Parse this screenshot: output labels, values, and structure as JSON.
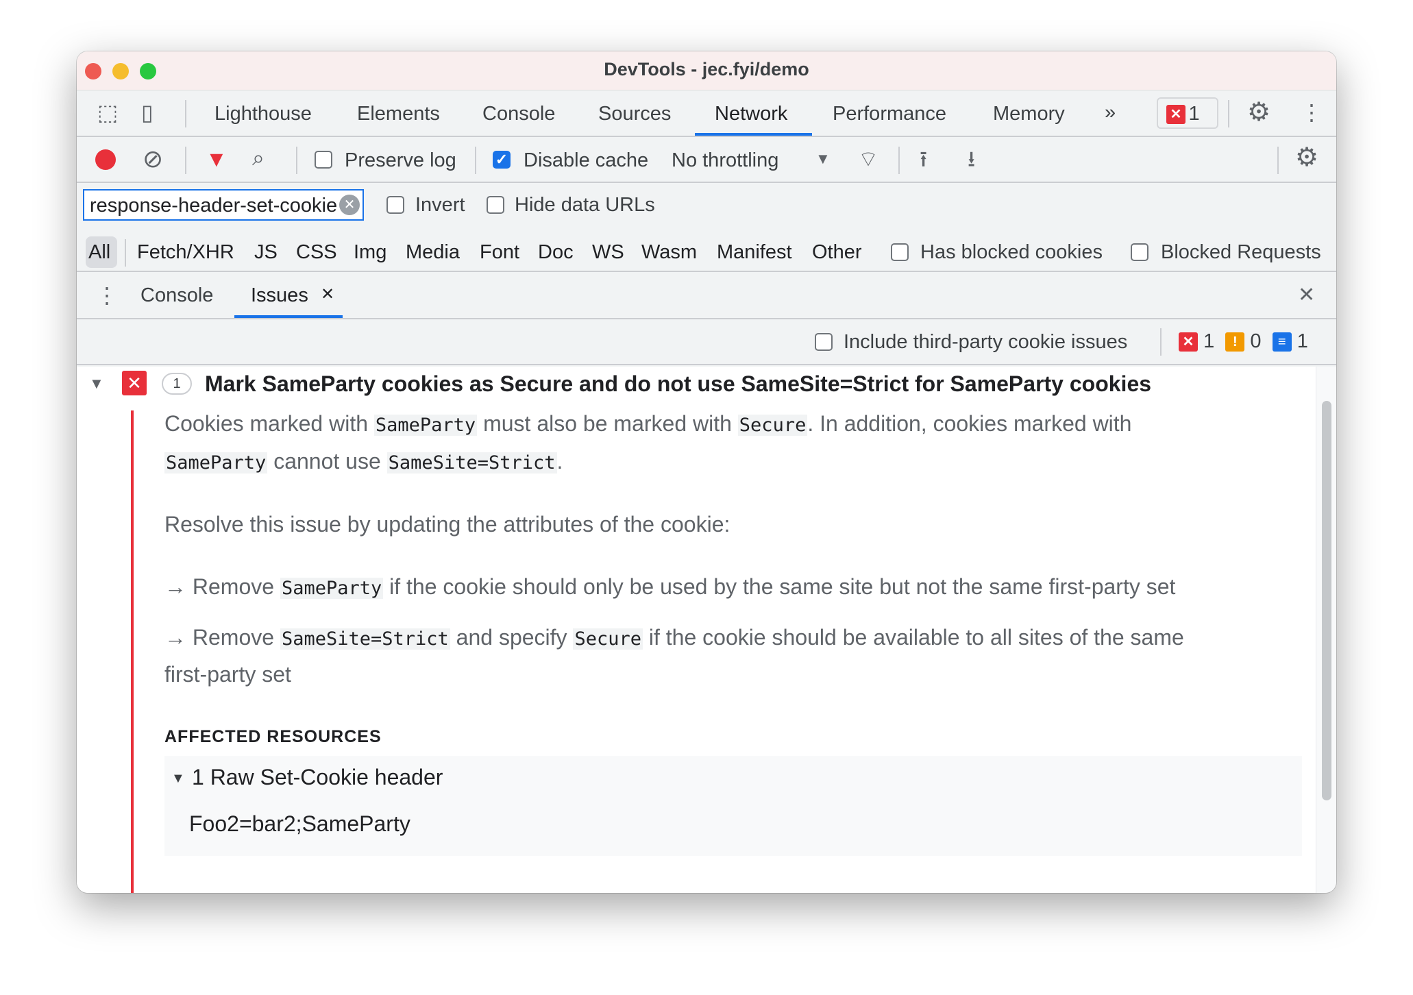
{
  "window": {
    "title": "DevTools - jec.fyi/demo"
  },
  "tabs": [
    {
      "label": "Lighthouse"
    },
    {
      "label": "Elements"
    },
    {
      "label": "Console"
    },
    {
      "label": "Sources"
    },
    {
      "label": "Network",
      "active": true
    },
    {
      "label": "Performance"
    },
    {
      "label": "Memory"
    }
  ],
  "tabs_more": "»",
  "issue_badge_count": "1",
  "toolbar": {
    "preserve_log": "Preserve log",
    "preserve_log_checked": false,
    "disable_cache": "Disable cache",
    "disable_cache_checked": true,
    "throttling": "No throttling"
  },
  "filter": {
    "value": "response-header-set-cookie",
    "invert": "Invert",
    "hide_data_urls": "Hide data URLs"
  },
  "types": [
    "All",
    "Fetch/XHR",
    "JS",
    "CSS",
    "Img",
    "Media",
    "Font",
    "Doc",
    "WS",
    "Wasm",
    "Manifest",
    "Other"
  ],
  "type_checks": {
    "has_blocked": "Has blocked cookies",
    "blocked_requests": "Blocked Requests"
  },
  "drawer": {
    "tabs": [
      "Console",
      "Issues"
    ],
    "active": "Issues",
    "close_glyph": "✕"
  },
  "issues_toolbar": {
    "third_party": "Include third-party cookie issues",
    "errors": "1",
    "warnings": "0",
    "info": "1"
  },
  "issue": {
    "count": "1",
    "title": "Mark SameParty cookies as Secure and do not use SameSite=Strict for SameParty cookies",
    "p1": [
      "Cookies marked with ",
      "SameParty",
      " must also be marked with ",
      "Secure",
      ". In addition, cookies marked with"
    ],
    "p1b": [
      "SameParty",
      " cannot use ",
      "SameSite=Strict",
      "."
    ],
    "p2": "Resolve this issue by updating the attributes of the cookie:",
    "b1": [
      "→ Remove ",
      "SameParty",
      " if the cookie should only be used by the same site but not the same first-party set"
    ],
    "b2": [
      "→ Remove ",
      "SameSite=Strict",
      " and specify ",
      "Secure",
      " if the cookie should be available to all sites of the same"
    ],
    "b2b": "first-party set",
    "affected_heading": "AFFECTED RESOURCES",
    "resource_group": "1 Raw Set-Cookie header",
    "resource_value": "Foo2=bar2;SameParty"
  },
  "colors": {
    "accent": "#1a73e8",
    "error": "#e8303a",
    "warning": "#f29900",
    "info": "#1a73e8"
  }
}
